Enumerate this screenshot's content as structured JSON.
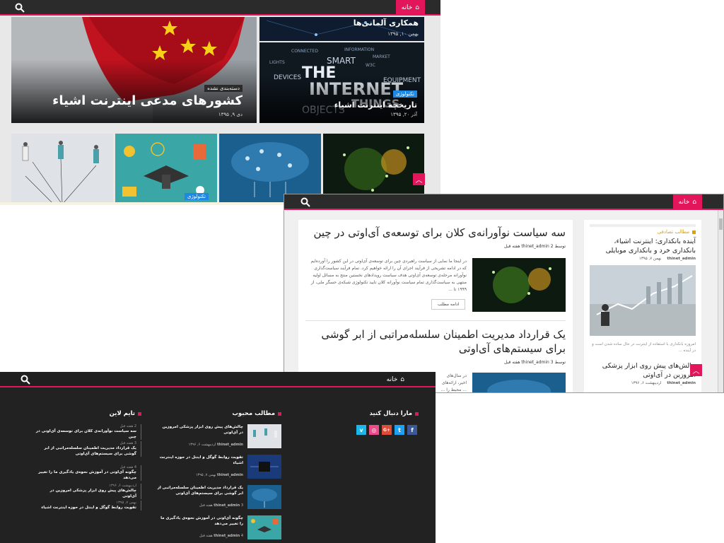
{
  "top_screenshot": {
    "nav": {
      "home": "خانه"
    },
    "hero_main": {
      "category": "دسته‌بندی نشده",
      "title": "کشورهای مدعی اینترنت اشیاء",
      "date": "دی ۹, ۱۳۹۵"
    },
    "hero_top_right": {
      "title": "همکاری آلمانی‌ها",
      "date": "بهمن ۱۰, ۱۳۹۵"
    },
    "hero_bottom_right": {
      "category": "تکنولوژی",
      "title": "تاریخچه اینترنت اشیاء",
      "date": "آذر ۲۰, ۱۳۹۵"
    },
    "thumb_category": "تکنولوژی"
  },
  "right_screenshot": {
    "nav": {
      "home": "خانه"
    },
    "article1": {
      "title": "سه سیاست نوآورانه‌ی کلان برای توسعه‌ی آی‌اوتی در چین",
      "meta": "توسط thinet_admin  2 هفته قبل",
      "excerpt": "در اینجا ما نمایی از سیاست راهبردی چین برای توسعه‌ی آی‌اوتی در این کشور را آورده‌ایم که در ادامه تشریحی از فرآیند اجرای آن را ارائه خواهیم کرد. تمام فرآیند سیاست‌گذاری نوآورانه مرحله‌ی توسعه‌ی آی‌اوتی هدف سیاست رویدادهای نخستین منتج به مسائل اولیه منتهی به سیاست‌گذاری تمام سیاست نوآورانه کلان تایید تکنولوژی شبکه‌ی حسگر ملی، از ۱۹۹۹ تا ...",
      "more": "ادامه مطلب"
    },
    "article2": {
      "title": "یک قرارداد مدیریت اطمینان سلسله‌مراتبی از ابر گوشی برای سیستم‌های آی‌اوتی",
      "meta": "توسط thinet_admin  3 هفته قبل",
      "excerpt": "در سال‌های اخیر، ارائه‌های ... محیط را ..."
    },
    "sidebar": {
      "heading": "مطالب تصادفی",
      "item1": {
        "title": "آینده بانکداری: اینترنت اشیاء، بانکداری خرد و بانکداری موبایلی",
        "meta_date": "بهمن ۷, ۱۳۹۵",
        "meta_author": "thinet_admin"
      },
      "excerpt": "امروزه بانکداری با استفاده از اینترنت در حال ساده شدن است و در آینده ...",
      "item2": {
        "title": "چالش‌های پیش روی ابزار پزشکی امروزین در آی‌اوتی",
        "meta_date": "اردیبهشت ۶, ۱۳۹۶",
        "meta_author": "thinet_admin"
      }
    }
  },
  "footer_screenshot": {
    "nav": {
      "home": "خانه"
    },
    "follow": {
      "heading": "مارا دنبال کنید",
      "icons": [
        "f",
        "t",
        "G+",
        "◎",
        "v"
      ]
    },
    "popular": {
      "heading": "مطالب محبوب",
      "items": [
        {
          "title": "چالش‌های پیش روی ابزار پزشکی امروزین در آی‌اوتی",
          "author": "thinet_admin",
          "date": "اردیبهشت ۶, ۱۳۹۶"
        },
        {
          "title": "تقویت روابط گوگل و اینتل در حوزه اینترنت اشیاء",
          "author": "thinet_admin",
          "date": "بهمن ۷, ۱۳۹۵"
        },
        {
          "title": "یک قرارداد مدیریت اطمینان سلسله‌مراتبی از ابر گوشی برای سیستم‌های آی‌اوتی",
          "author": "thinet_admin",
          "date": "3 هفته قبل"
        },
        {
          "title": "چگونه آی‌اوتی در آموزش نحوه‌ی یادگیری ما را تغییر می‌دهد",
          "author": "thinet_admin",
          "date": "4 هفته قبل"
        }
      ]
    },
    "timeline": {
      "heading": "تایم لاین",
      "items": [
        {
          "date": "2 هفته قبل",
          "title": "سه سیاست نوآورانه‌ی کلان برای توسعه‌ی آی‌اوتی در چین"
        },
        {
          "date": "3 هفته قبل",
          "title": "یک قرارداد مدیریت اطمینان سلسله‌مراتبی از ابر گوشی برای سیستم‌های آی‌اوتی"
        },
        {
          "date": "4 هفته قبل",
          "title": "چگونه آی‌اوتی در آموزش نحوه‌ی یادگیری ما را تغییر می‌دهد"
        },
        {
          "date": "اردیبهشت ۶, ۱۳۹۶",
          "title": "چالش‌های پیش روی ابزار پزشکی امروزین در آی‌اوتی"
        },
        {
          "date": "بهمن ۷, ۱۳۹۵",
          "title": "تقویت روابط گوگل و اینتل در حوزه اینترنت اشیاء"
        }
      ]
    }
  },
  "colors": {
    "accent": "#e3165b",
    "bar": "#2b2b2b",
    "footer": "#222222"
  }
}
